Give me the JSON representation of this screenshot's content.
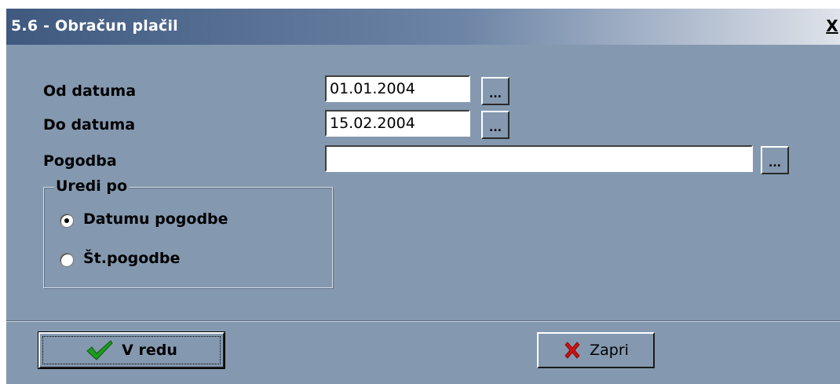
{
  "window": {
    "title": "5.6 - Obračun plačil",
    "close_label": "X"
  },
  "fields": {
    "od_datuma": {
      "label": "Od datuma",
      "value": "01.01.2004",
      "button": "..."
    },
    "do_datuma": {
      "label": "Do datuma",
      "value": "15.02.2004",
      "button": "..."
    },
    "pogodba": {
      "label": "Pogodba",
      "value": "",
      "button": "..."
    }
  },
  "sort_group": {
    "title": "Uredi po",
    "options": [
      {
        "label": "Datumu pogodbe",
        "selected": true
      },
      {
        "label": "Št.pogodbe",
        "selected": false
      }
    ]
  },
  "buttons": {
    "ok": {
      "label": "V redu",
      "icon": "checkmark-icon",
      "color": "#1e9a1e"
    },
    "close": {
      "label": "Zapri",
      "icon": "red-x-icon",
      "color": "#cc1111"
    }
  },
  "colors": {
    "dialog_bg": "#8499b0",
    "title_start": "#3f597f",
    "title_end": "#dfe3ea"
  }
}
